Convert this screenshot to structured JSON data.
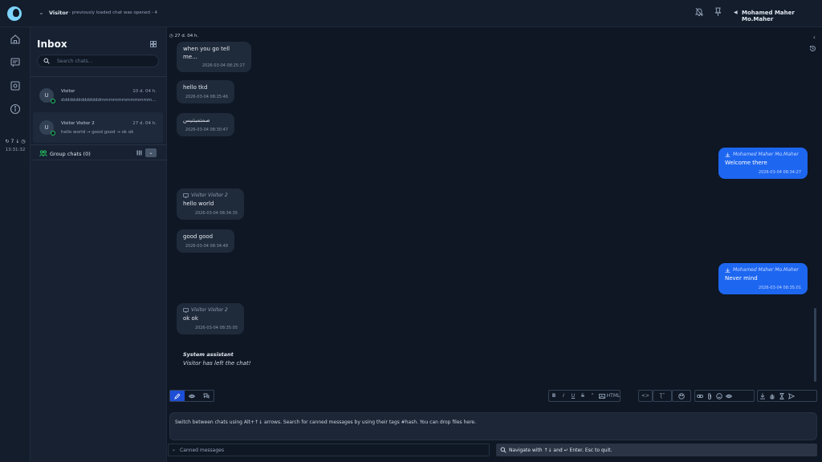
{
  "header": {
    "visitor": "Visitor",
    "subtitle": "- previously loaded chat was opened - 4",
    "user": "Mohamed Maher Mo.Maher"
  },
  "rail": {
    "status": "7 ↓",
    "time": "13:31:32"
  },
  "inbox": {
    "title": "Inbox",
    "search_placeholder": "Search chats...",
    "chats": [
      {
        "avatar": "U",
        "name": "Visitor",
        "time": "10 d. 04 h.",
        "preview": "ddddddddddddddmmmmmmmmmmmmmmmmmmmm..."
      },
      {
        "avatar": "U",
        "name": "Visitor Visitor 2",
        "time": "27 d. 04 h.",
        "preview": "hello world → good good → ok ok"
      }
    ],
    "group_label": "Group chats (0)",
    "group_toggle": "⌄"
  },
  "conversation": {
    "date": "27 d. 04 h.",
    "messages": [
      {
        "dir": "in",
        "text": "when you go tell me...",
        "time": "2026-03-04 08:25:27"
      },
      {
        "dir": "in",
        "text": "hello tkd",
        "time": "2026-03-04 08:25:46"
      },
      {
        "dir": "in",
        "text": "صمتميتنيس",
        "time": "2026-03-04 08:30:47"
      },
      {
        "dir": "out",
        "sender": "Mohamed Maher Mo.Maher",
        "text": "Welcome there",
        "time": "2026-03-04 08:34:27"
      },
      {
        "dir": "in",
        "sender": "Visitor Visitor 2",
        "text": "hello world",
        "time": "2026-03-04 08:34:35"
      },
      {
        "dir": "in",
        "text": "good good",
        "time": "2026-03-04 08:34:48"
      },
      {
        "dir": "out",
        "sender": "Mohamed Maher Mo.Maher",
        "text": "Never mind",
        "time": "2026-03-04 08:35:01"
      },
      {
        "dir": "in",
        "sender": "Visitor Visitor 2",
        "text": "ok ok",
        "time": "2026-03-04 08:35:05"
      }
    ],
    "system_title": "System assistant",
    "system_text": "Visitor has left the chat!"
  },
  "toolbar": {
    "html_label": "HTML",
    "code_label": "<>",
    "text_size_label": "Ʈ˅"
  },
  "composer": {
    "hint": "Switch between chats using Alt+↑↓ arrows. Search for canned messages by using their tags #hash. You can drop files here.",
    "canned_label": "Canned messages",
    "nav_label": "Navigate with ↑↓ and ↵ Enter. Esc to quit."
  }
}
